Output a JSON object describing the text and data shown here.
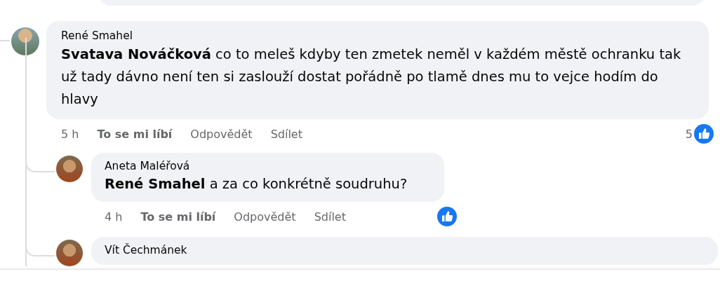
{
  "comments": [
    {
      "author": "René Smahel",
      "mention": "Svatava Nováčková",
      "text": "co to meleš kdyby ten zmetek neměl v každém městě ochranku tak už tady dávno není ten si zaslouží dostat pořádně po tlamě dnes mu to vejce hodím do hlavy",
      "time": "5 h",
      "actions": [
        "To se mi líbí",
        "Odpovědět",
        "Sdílet"
      ],
      "reaction_count": "5",
      "replies": [
        {
          "author": "Aneta Maléřová",
          "mention": "René Smahel",
          "text": "a za co konkrétně soudruhu?",
          "time": "4 h",
          "actions": [
            "To se mi líbí",
            "Odpovědět",
            "Sdílet"
          ]
        },
        {
          "author": "Vít Čechmánek"
        }
      ]
    }
  ]
}
